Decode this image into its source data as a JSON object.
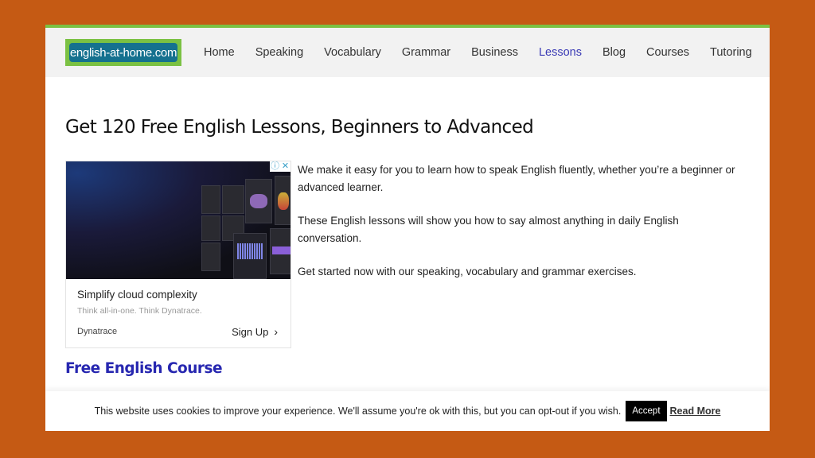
{
  "site": {
    "logo_text": "english-at-home.com",
    "colors": {
      "background": "#c55a14",
      "accent_green": "#7bc143",
      "logo_blue": "#15718f",
      "active_nav": "#3b3bb5",
      "section_heading": "#2727b0"
    }
  },
  "nav": {
    "items": [
      {
        "label": "Home"
      },
      {
        "label": "Speaking"
      },
      {
        "label": "Vocabulary"
      },
      {
        "label": "Grammar"
      },
      {
        "label": "Business"
      },
      {
        "label": "Lessons",
        "active": true
      },
      {
        "label": "Blog"
      },
      {
        "label": "Courses"
      },
      {
        "label": "Tutoring"
      }
    ]
  },
  "main": {
    "title": "Get 120 Free English Lessons, Beginners to Advanced",
    "paragraphs": [
      "We make it easy for you to learn how to speak English fluently, whether you’re a beginner or advanced learner.",
      "These English lessons will show you how to say almost anything in daily English conversation.",
      "Get started now with our speaking, vocabulary and grammar exercises."
    ],
    "section_heading": "Free English Course"
  },
  "ad": {
    "info_icon": "info-icon",
    "close_icon": "close-icon",
    "headline": "Simplify cloud complexity",
    "subtext": "Think all-in-one. Think Dynatrace.",
    "brand": "Dynatrace",
    "cta_label": "Sign Up",
    "cta_icon": "chevron-right-icon"
  },
  "cookie_bar": {
    "message": "This website uses cookies to improve your experience. We'll assume you're ok with this, but you can opt-out if you wish.",
    "accept_label": "Accept",
    "read_more_label": "Read More"
  }
}
